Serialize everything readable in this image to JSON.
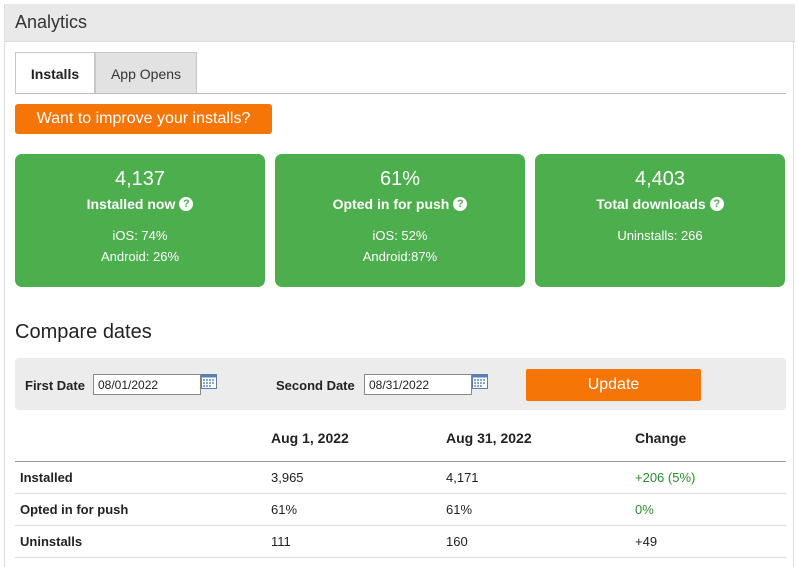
{
  "header": {
    "title": "Analytics"
  },
  "tabs": [
    {
      "label": "Installs",
      "active": true
    },
    {
      "label": "App Opens",
      "active": false
    }
  ],
  "improve_button": {
    "label": "Want to improve your installs?"
  },
  "cards": [
    {
      "value": "4,137",
      "label": "Installed now",
      "line1": "iOS: 74%",
      "line2": "Android: 26%"
    },
    {
      "value": "61%",
      "label": "Opted in for push",
      "line1": "iOS: 52%",
      "line2": "Android:87%"
    },
    {
      "value": "4,403",
      "label": "Total downloads",
      "line1": "Uninstalls: 266",
      "line2": ""
    }
  ],
  "compare": {
    "title": "Compare dates",
    "first_label": "First Date",
    "first_value": "08/01/2022",
    "second_label": "Second Date",
    "second_value": "08/31/2022",
    "update_label": "Update"
  },
  "table": {
    "headers": [
      "",
      "Aug 1, 2022",
      "Aug 31, 2022",
      "Change"
    ],
    "rows": [
      {
        "metric": "Installed",
        "aug1": "3,965",
        "aug31": "4,171",
        "change": "+206 (5%)"
      },
      {
        "metric": "Opted in for push",
        "aug1": "61%",
        "aug31": "61%",
        "change": "0%"
      },
      {
        "metric": "Uninstalls",
        "aug1": "111",
        "aug31": "160",
        "change": "+49"
      }
    ]
  },
  "colors": {
    "accent_orange": "#f57507",
    "card_green": "#4cae4c",
    "positive_green": "#2a8a2a"
  }
}
